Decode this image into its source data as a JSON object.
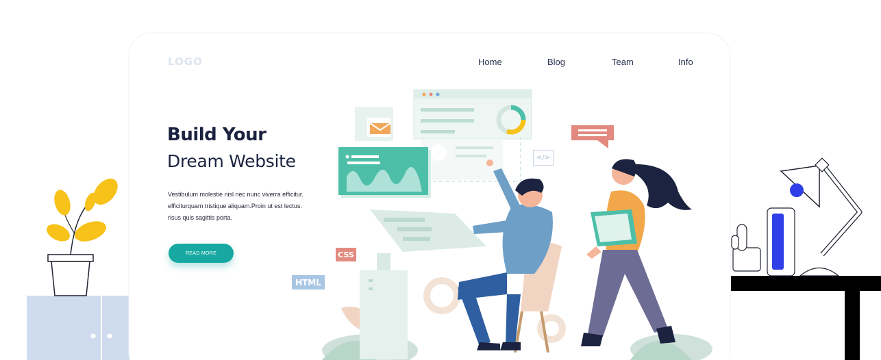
{
  "header": {
    "logo": "LOGO",
    "nav": [
      "Home",
      "Blog",
      "Team",
      "Info"
    ]
  },
  "hero": {
    "title_line1": "Build Your",
    "title_line2": "Dream Website",
    "description_lines": [
      "Vestibulum molestie nisl nec nunc viverra efficitur.",
      "efficiturquam tristique aliquam.Proin ut est lectus.",
      "risus quis sagittis porta."
    ],
    "button_label": "READ MORE"
  },
  "illustration": {
    "tags": [
      "CSS",
      "HTML",
      "</>"
    ]
  },
  "colors": {
    "accent": "#17a8a2",
    "heading": "#1c2340",
    "coral": "#e28a7f",
    "teal_panel": "#4dbfa9",
    "plant_yellow": "#f7c21a",
    "cabinet_blue": "#cfdcef"
  }
}
